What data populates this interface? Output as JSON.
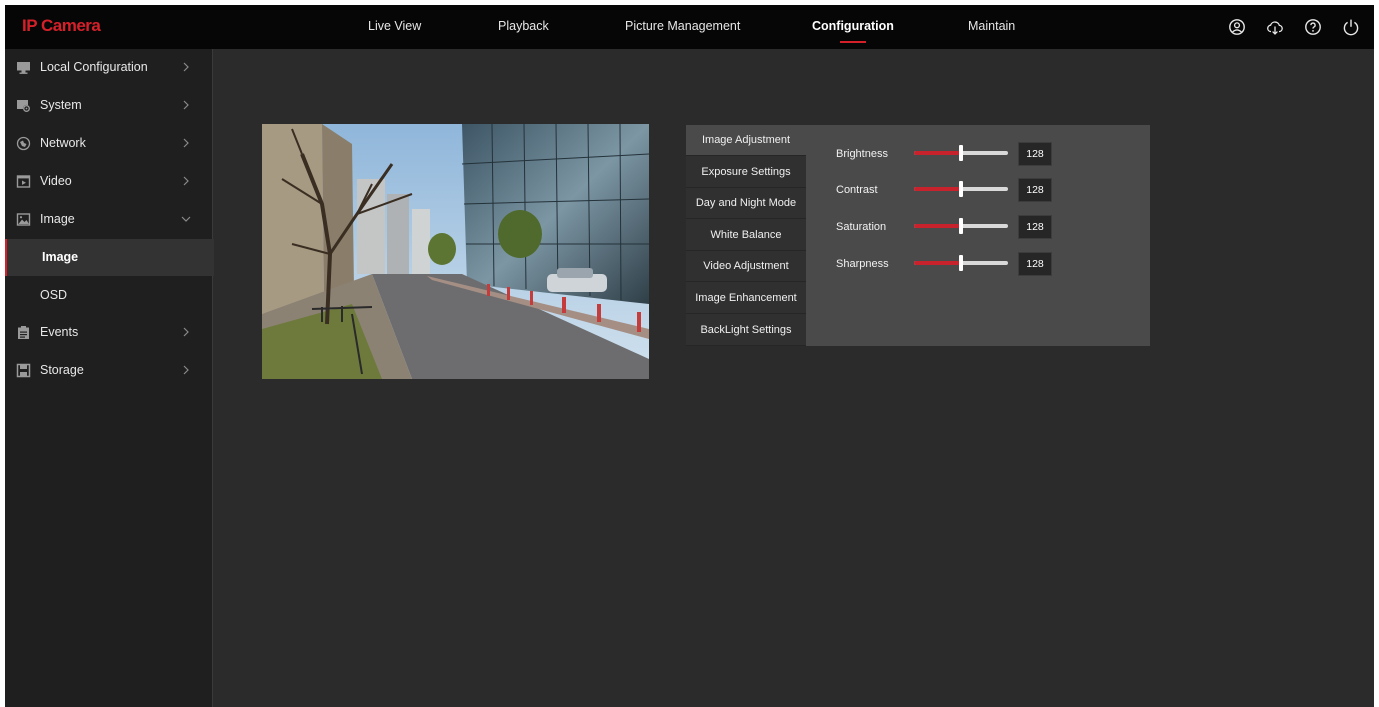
{
  "app": {
    "title": "IP Camera",
    "brand_color": "#d5202a"
  },
  "nav": {
    "items": [
      {
        "label": "Live View"
      },
      {
        "label": "Playback"
      },
      {
        "label": "Picture Management"
      },
      {
        "label": "Configuration",
        "active": true
      },
      {
        "label": "Maintain"
      }
    ],
    "icons": [
      "user-icon",
      "cloud-download-icon",
      "help-icon",
      "power-icon"
    ]
  },
  "sidebar": {
    "items": [
      {
        "label": "Local Configuration",
        "icon": "monitor-icon"
      },
      {
        "label": "System",
        "icon": "system-icon"
      },
      {
        "label": "Network",
        "icon": "network-icon"
      },
      {
        "label": "Video",
        "icon": "video-icon"
      },
      {
        "label": "Image",
        "icon": "image-icon",
        "expanded": true
      },
      {
        "label": "Events",
        "icon": "events-icon"
      },
      {
        "label": "Storage",
        "icon": "storage-icon"
      }
    ],
    "sub_items": [
      {
        "label": "Image",
        "active": true
      },
      {
        "label": "OSD"
      }
    ]
  },
  "panel": {
    "tabs": [
      {
        "label": "Image Adjustment",
        "active": true
      },
      {
        "label": "Exposure Settings"
      },
      {
        "label": "Day and Night Mode"
      },
      {
        "label": "White Balance"
      },
      {
        "label": "Video Adjustment"
      },
      {
        "label": "Image Enhancement"
      },
      {
        "label": "BackLight Settings"
      }
    ],
    "settings": [
      {
        "label": "Brightness",
        "value": "128",
        "level": 0.5
      },
      {
        "label": "Contrast",
        "value": "128",
        "level": 0.5
      },
      {
        "label": "Saturation",
        "value": "128",
        "level": 0.5
      },
      {
        "label": "Sharpness",
        "value": "128",
        "level": 0.5
      }
    ],
    "slider_fill_color": "#c8222c",
    "slider_track_color": "#d9d9d9"
  }
}
